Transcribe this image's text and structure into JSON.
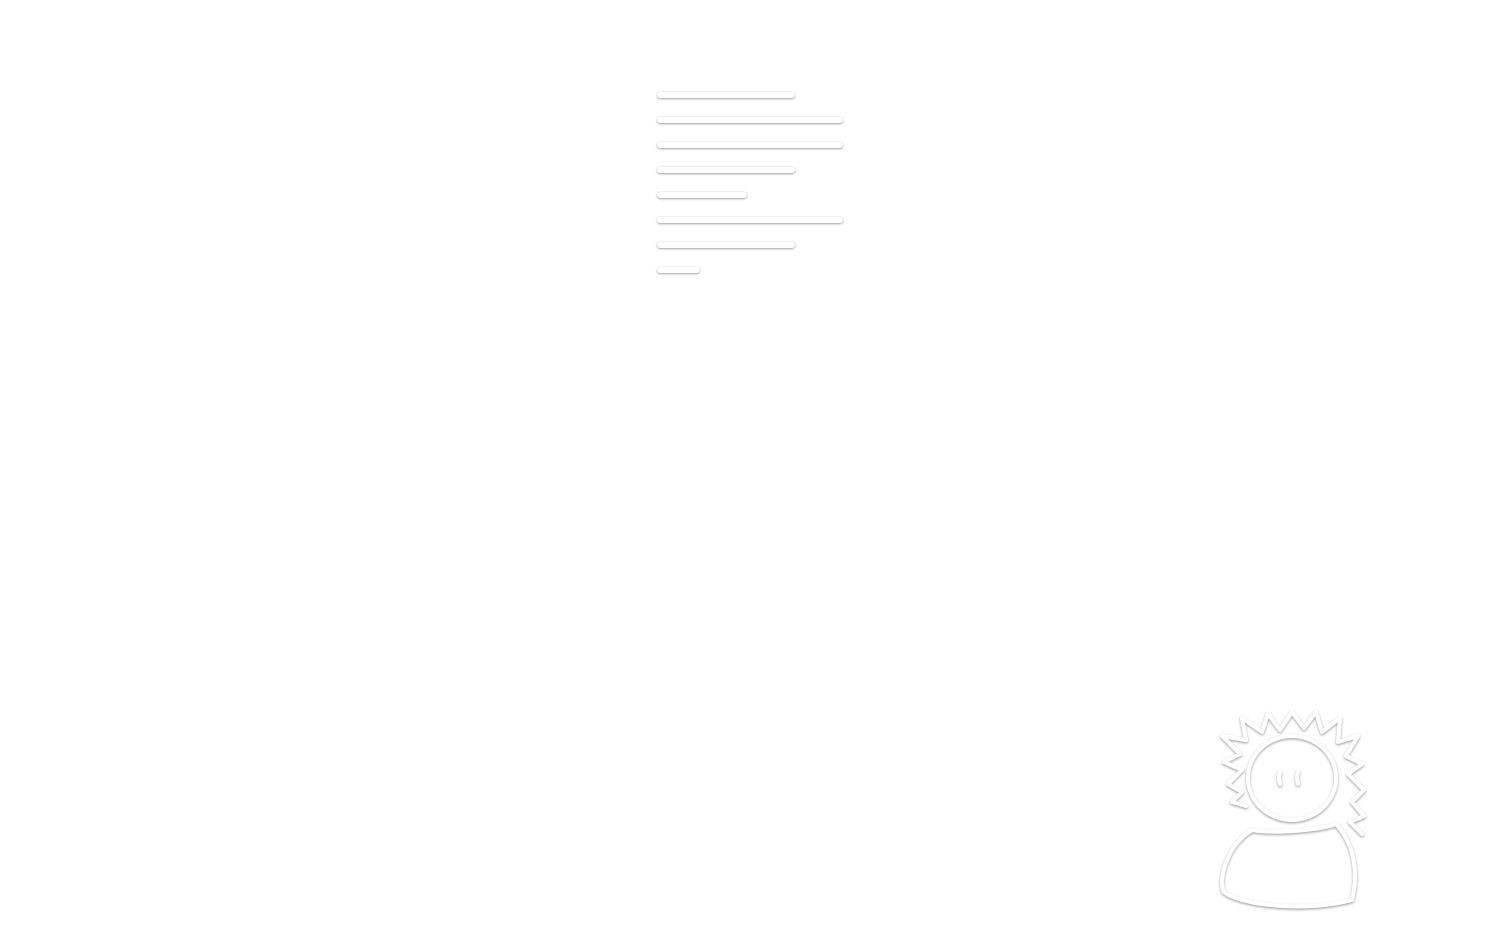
{
  "placeholder": {
    "line_count": 8
  },
  "mascot": {
    "icon": "spiky-hair-character-icon",
    "stroke_color": "#ffffff",
    "shadow_color": "#9a9a9a"
  }
}
